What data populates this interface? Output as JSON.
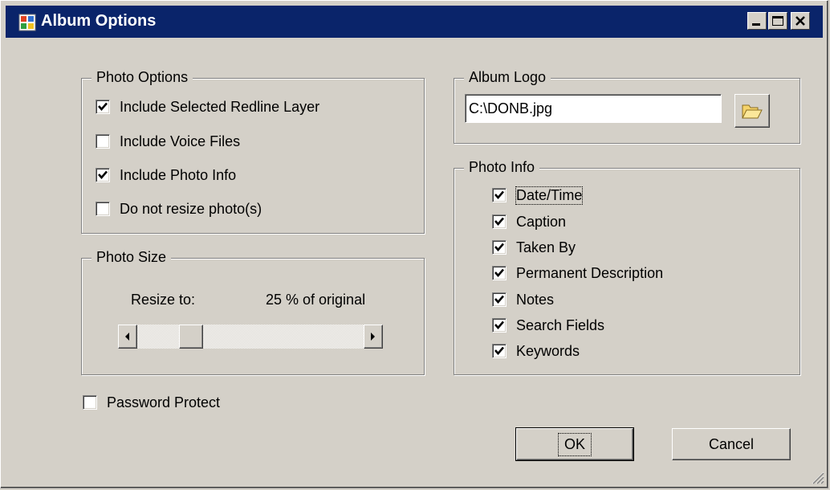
{
  "window": {
    "title": "Album Options"
  },
  "photo_options": {
    "legend": "Photo Options",
    "items": [
      {
        "label": "Include Selected Redline Layer",
        "checked": true
      },
      {
        "label": "Include Voice Files",
        "checked": false
      },
      {
        "label": "Include Photo Info",
        "checked": true
      },
      {
        "label": "Do not resize photo(s)",
        "checked": false
      }
    ]
  },
  "photo_size": {
    "legend": "Photo Size",
    "resize_label": "Resize to:",
    "percent_text": "25 % of original",
    "percent_value": 25
  },
  "password": {
    "label": "Password Protect",
    "checked": false
  },
  "album_logo": {
    "legend": "Album Logo",
    "path_value": "C:\\DONB.jpg",
    "browse_icon": "folder-open-icon"
  },
  "photo_info": {
    "legend": "Photo Info",
    "items": [
      {
        "label": "Date/Time",
        "checked": true
      },
      {
        "label": "Caption",
        "checked": true
      },
      {
        "label": "Taken By",
        "checked": true
      },
      {
        "label": "Permanent Description",
        "checked": true
      },
      {
        "label": "Notes",
        "checked": true
      },
      {
        "label": "Search Fields",
        "checked": true
      },
      {
        "label": "Keywords",
        "checked": true
      }
    ]
  },
  "buttons": {
    "ok": "OK",
    "cancel": "Cancel"
  },
  "colors": {
    "titlebar": "#0a246a",
    "face": "#d4d0c8",
    "folder": "#f5d36b"
  }
}
